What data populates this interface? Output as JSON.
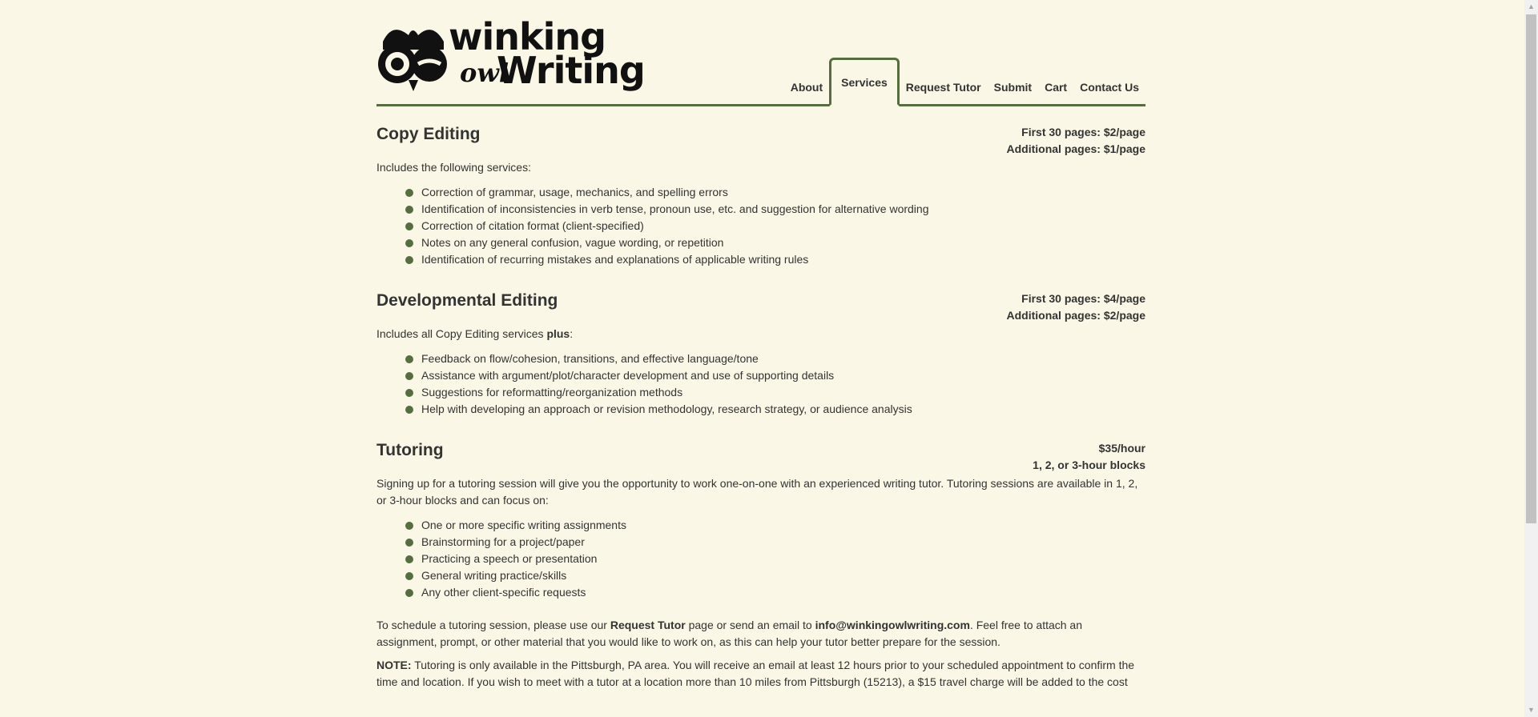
{
  "logo": {
    "line1": "winking",
    "line2": "Writing",
    "script": "owl"
  },
  "nav": {
    "items": [
      "About",
      "Services",
      "Request Tutor",
      "Submit",
      "Cart",
      "Contact Us"
    ],
    "active": "Services"
  },
  "sections": [
    {
      "title": "Copy Editing",
      "prices": [
        "First 30 pages: $2/page",
        "Additional pages: $1/page"
      ],
      "intro": "Includes the following services:",
      "bullets": [
        "Correction of grammar, usage, mechanics, and spelling errors",
        "Identification of inconsistencies in verb tense, pronoun use, etc. and suggestion for alternative wording",
        "Correction of citation format (client-specified)",
        "Notes on any general confusion, vague wording, or repetition",
        "Identification of recurring mistakes and explanations of applicable writing rules"
      ]
    },
    {
      "title": "Developmental Editing",
      "prices": [
        "First 30 pages: $4/page",
        "Additional pages: $2/page"
      ],
      "intro_prefix": "Includes all Copy Editing services ",
      "intro_bold": "plus",
      "intro_suffix": ":",
      "bullets": [
        "Feedback on flow/cohesion, transitions, and effective language/tone",
        "Assistance with argument/plot/character development and use of supporting details",
        "Suggestions for reformatting/reorganization methods",
        "Help with developing an approach or revision methodology, research strategy, or audience analysis"
      ]
    },
    {
      "title": "Tutoring",
      "prices": [
        "$35/hour",
        "1, 2, or 3-hour blocks"
      ],
      "intro": "Signing up for a tutoring session will give you the opportunity to work one-on-one with an experienced writing tutor. Tutoring sessions are available in 1, 2, or 3-hour blocks and can focus on:",
      "bullets": [
        "One or more specific writing assignments",
        "Brainstorming for a project/paper",
        "Practicing a speech or presentation",
        "General writing practice/skills",
        "Any other client-specific requests"
      ],
      "schedule_p1": "To schedule a tutoring session, please use our ",
      "schedule_b1": "Request Tutor",
      "schedule_p2": " page or send an email to ",
      "schedule_b2": "info@winkingowlwriting.com",
      "schedule_p3": ". Feel free to attach an assignment, prompt, or other material that you would like to work on, as this can help your tutor better prepare for the session.",
      "note_label": "NOTE:",
      "note_text": " Tutoring is only available in the Pittsburgh, PA area. You will receive an email at least 12 hours prior to your scheduled appointment to confirm the time and location. If you wish to meet with a tutor at a location more than 10 miles from Pittsburgh (15213), a $15 travel charge will be added to the cost"
    }
  ],
  "colors": {
    "background": "#faf7e6",
    "accent": "#566d3f",
    "text": "#333333"
  }
}
